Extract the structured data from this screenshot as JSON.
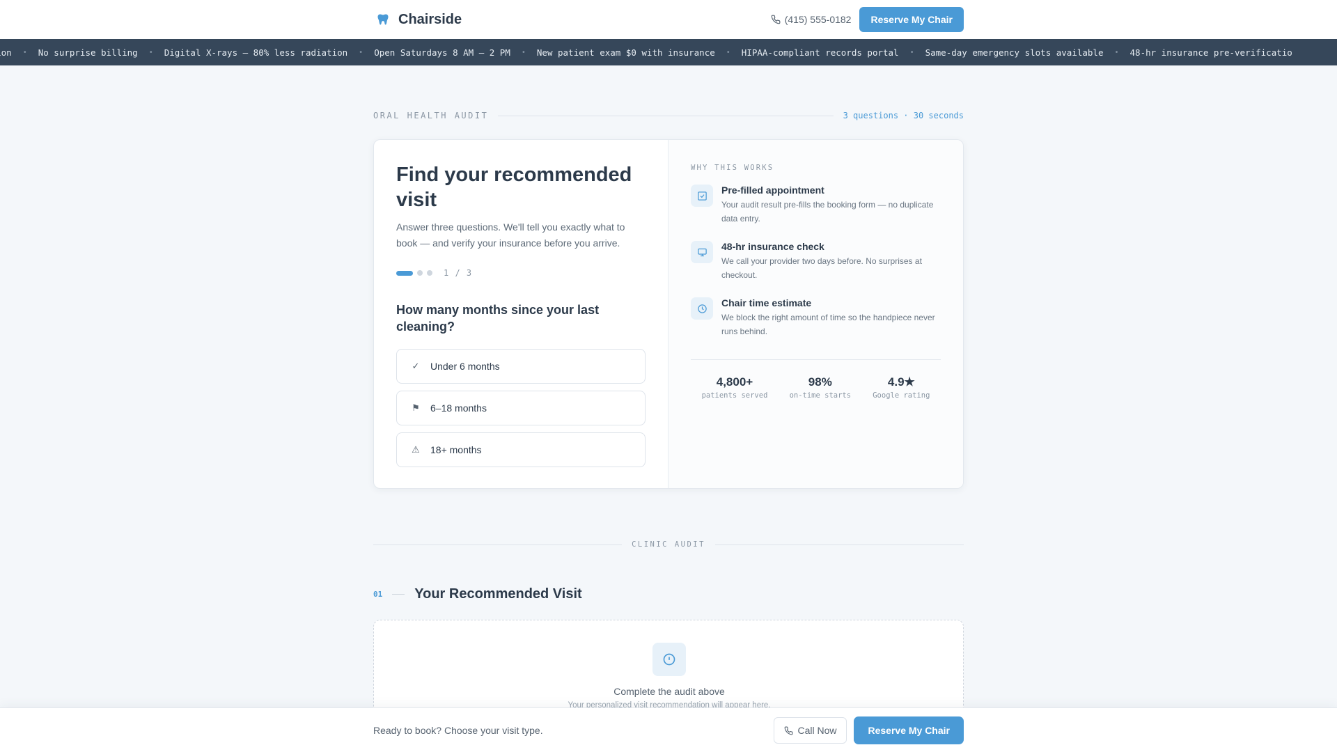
{
  "header": {
    "brand": "Chairside",
    "brand_icon": "tooth-icon",
    "phone": "(415) 555-0182",
    "cta": "Reserve My Chair"
  },
  "ticker": {
    "items": [
      "ication",
      "No surprise billing",
      "Digital X-rays — 80% less radiation",
      "Open Saturdays 8 AM – 2 PM",
      "New patient exam $0 with insurance",
      "HIPAA-compliant records portal",
      "Same-day emergency slots available",
      "48-hr insurance pre-verificatio"
    ]
  },
  "audit": {
    "eyebrow": "ORAL HEALTH AUDIT",
    "meta": "3 questions · 30 seconds",
    "title": "Find your recommended visit",
    "subtitle": "Answer three questions. We'll tell you exactly what to book — and verify your insurance before you arrive.",
    "step": 1,
    "step_total": 3,
    "step_label": "1 / 3",
    "question": "How many months since your last cleaning?",
    "options": [
      {
        "icon": "check-icon",
        "glyph": "✓",
        "label": "Under 6 months"
      },
      {
        "icon": "flag-icon",
        "glyph": "⚑",
        "label": "6–18 months"
      },
      {
        "icon": "warning-icon",
        "glyph": "⚠",
        "label": "18+ months"
      }
    ]
  },
  "why": {
    "eyebrow": "WHY THIS WORKS",
    "features": [
      {
        "icon": "checkbox-icon",
        "title": "Pre-filled appointment",
        "desc": "Your audit result pre-fills the booking form — no duplicate data entry."
      },
      {
        "icon": "monitor-icon",
        "title": "48-hr insurance check",
        "desc": "We call your provider two days before. No surprises at checkout."
      },
      {
        "icon": "clock-icon",
        "title": "Chair time estimate",
        "desc": "We block the right amount of time so the handpiece never runs behind."
      }
    ],
    "stats": [
      {
        "value": "4,800+",
        "label": "patients served"
      },
      {
        "value": "98%",
        "label": "on-time starts"
      },
      {
        "value": "4.9★",
        "label": "Google rating"
      }
    ]
  },
  "clinic": {
    "divider": "CLINIC AUDIT",
    "section_number": "01",
    "section_title": "Your Recommended Visit",
    "empty_icon": "info-icon",
    "empty_message": "Complete the audit above",
    "empty_hint": "Your personalized visit recommendation will appear here."
  },
  "footer": {
    "text": "Ready to book? Choose your visit type.",
    "call": "Call Now",
    "cta": "Reserve My Chair"
  },
  "colors": {
    "accent": "#4a9ad6",
    "ticker_bg": "#36475a",
    "background": "#f4f7fa"
  }
}
